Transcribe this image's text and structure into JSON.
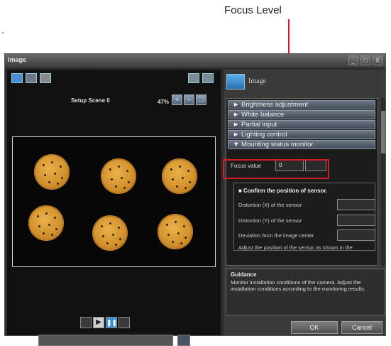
{
  "callout": {
    "label": "Focus Level",
    "dot": "."
  },
  "window": {
    "title": "Image",
    "buttons": [
      "_",
      "□",
      "X"
    ]
  },
  "left_pane": {
    "scene_label": "Setup Scene 0",
    "zoom_label": "47%",
    "toolbar_icons": [
      "display-icon",
      "image-list-icon",
      "folder-icon"
    ],
    "view_icons": [
      "grid-icon",
      "fit-view-icon"
    ],
    "zoom_icons": [
      "zoom-in-icon",
      "zoom-out-icon",
      "fit-icon"
    ],
    "playback_icons": [
      "step-back-icon",
      "play-icon",
      "pause-icon",
      "step-forward-icon"
    ]
  },
  "right_pane": {
    "title": "Image",
    "menu_items": [
      "► Brightness adjustment",
      "► White balance",
      "► Partial input",
      "► Lighting control",
      "▼ Mounting status monitor"
    ],
    "focus": {
      "label": "Focus value",
      "value": "0"
    },
    "confirm_section": {
      "header": "■ Confirm the position of sensor.",
      "rows": [
        "Distortion (X) of the sensor",
        "Distortion (Y) of the sensor",
        "Deviation from the image center",
        "Adjust the position of the sensor as shown in the"
      ]
    },
    "guidance": {
      "title": "Guidance",
      "text": "Monitor installation conditions of the camera. Adjust the installation conditions according to the monitoring results."
    },
    "ok_label": "OK",
    "cancel_label": "Cancel"
  },
  "colors": {
    "accent": "#d11a2a",
    "menu_bg": "#5a6572",
    "window_bg": "#2b2b2b"
  }
}
